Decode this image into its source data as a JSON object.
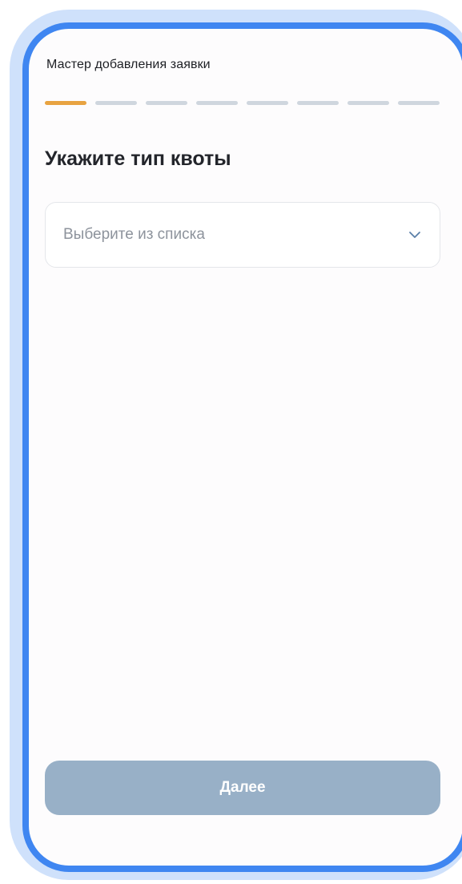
{
  "wizard": {
    "title": "Мастер добавления заявки",
    "steps_total": 8,
    "current_step": 1
  },
  "question": {
    "title": "Укажите тип квоты"
  },
  "quota_select": {
    "placeholder": "Выберите из списка",
    "icon": "chevron-down-icon"
  },
  "footer": {
    "next_label": "Далее",
    "next_enabled": false
  },
  "colors": {
    "frame_outer": "#cfe1fb",
    "frame_border": "#3f86f1",
    "step_active": "#e8a341",
    "step_inactive": "#cfd6de",
    "button_disabled": "#98b0c7",
    "chevron": "#5a7fa8"
  }
}
